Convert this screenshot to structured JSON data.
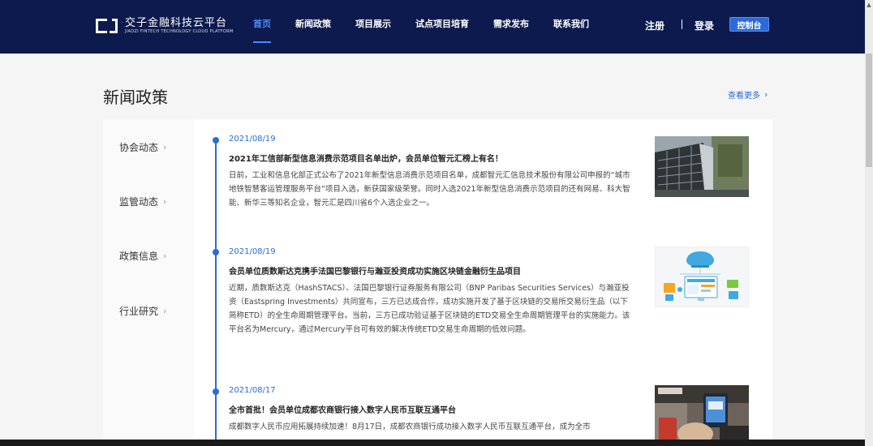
{
  "header": {
    "logo_cn": "交子金融科技云平台",
    "logo_en": "JIAOZI FINTECH TECHNOLOGY CLOUD PLATFORM",
    "nav": [
      {
        "label": "首页",
        "active": true
      },
      {
        "label": "新闻政策",
        "active": false
      },
      {
        "label": "项目展示",
        "active": false
      },
      {
        "label": "试点项目培育",
        "active": false
      },
      {
        "label": "需求发布",
        "active": false
      },
      {
        "label": "联系我们",
        "active": false
      }
    ],
    "register": "注册",
    "login": "登录",
    "console": "控制台"
  },
  "section": {
    "title": "新闻政策",
    "view_more": "查看更多"
  },
  "sidebar": {
    "items": [
      {
        "label": "协会动态"
      },
      {
        "label": "监管动态"
      },
      {
        "label": "政策信息"
      },
      {
        "label": "行业研究"
      }
    ]
  },
  "news": [
    {
      "date": "2021/08/19",
      "title": "2021年工信部新型信息消费示范项目名单出炉，会员单位智元汇榜上有名！",
      "body": "日前，工业和信息化部正式公布了2021年新型信息消费示范项目名单，成都智元汇信息技术股份有限公司申报的“城市地铁智慧客运管理服务平台”项目入选，新获国家级荣誉。同时入选2021年新型信息消费示范项目的还有网易、科大智能、新华三等知名企业，智元汇是四川省6个入选企业之一。"
    },
    {
      "date": "2021/08/19",
      "title": "会员单位质数斯达克携手法国巴黎银行与瀚亚投资成功实施区块链金融衍生品项目",
      "body": "近期，质数斯达克（HashSTACS）、法国巴黎银行证券服务有限公司（BNP Paribas Securities Services）与瀚亚投资（Eastspring Investments）共同宣布，三方已达成合作，成功实施开发了基于区块链的交易所交易衍生品（以下简称ETD）的全生命周期管理平台。当前，三方已成功验证基于区块链的ETD交易全生命周期管理平台的实施能力。该平台名为Mercury，通过Mercury平台可有效的解决传统ETD交易生命周期的低效问题。"
    },
    {
      "date": "2021/08/17",
      "title": "全市首批！会员单位成都农商银行接入数字人民币互联互通平台",
      "body": "成都数字人民币应用拓展持续加速！8月17日，成都农商银行成功接入数字人民币互联互通平台，成为全市"
    }
  ]
}
